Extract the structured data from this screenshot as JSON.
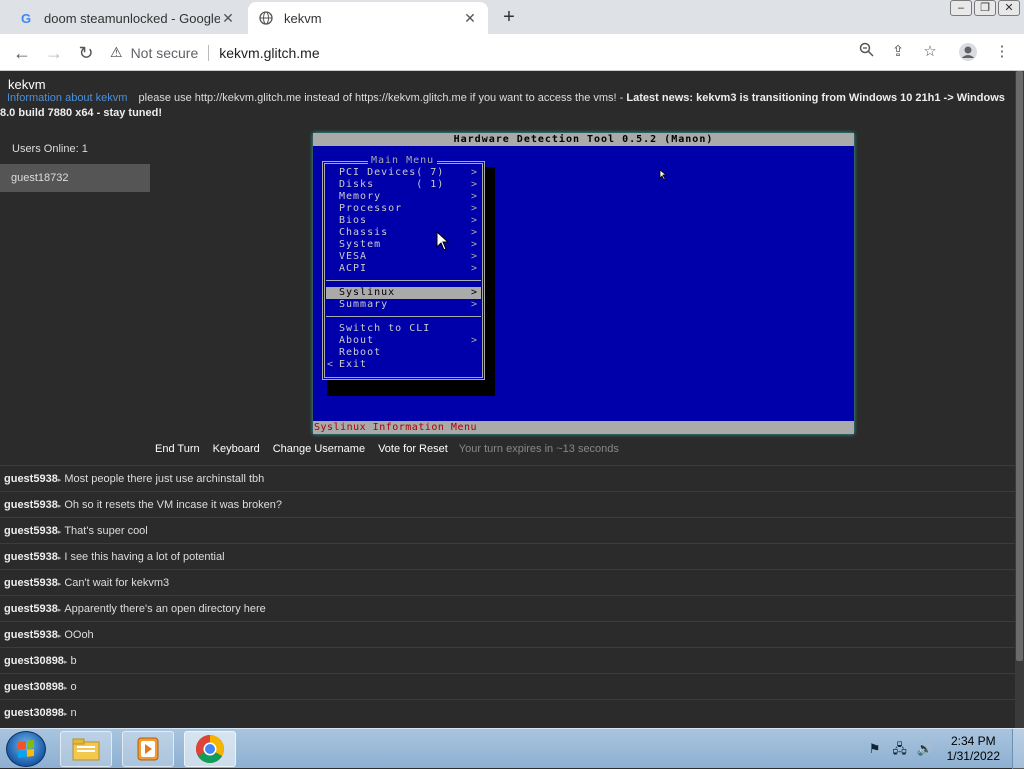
{
  "browser": {
    "tabs": [
      {
        "title": "doom steamunlocked - Google S",
        "favicon": "google-g-icon"
      },
      {
        "title": "kekvm",
        "favicon": "globe-icon"
      }
    ],
    "new_tab": "+",
    "window_controls": [
      "minimize",
      "restore",
      "close"
    ],
    "security_label": "Not secure",
    "url": "kekvm.glitch.me"
  },
  "site": {
    "title": "kekvm",
    "info_link": "Information about kekvm",
    "notice": "please use http://kekvm.glitch.me instead of https://kekvm.glitch.me if you want to access the vms!",
    "news_sep": " - ",
    "news": "Latest news: kekvm3 is transitioning from Windows 10 21h1 -> Windows 8.0 build 7880 x64 - stay tuned!",
    "users_online": "Users Online: 1",
    "users": [
      "guest18732"
    ]
  },
  "vm": {
    "title": "Hardware Detection Tool 0.5.2 (Manon)",
    "menu_title": "Main Menu",
    "items": [
      {
        "label": "PCI Devices( 7)",
        "arrow": ">",
        "type": "item"
      },
      {
        "label": "Disks      ( 1)",
        "arrow": ">",
        "type": "item"
      },
      {
        "label": "Memory",
        "arrow": ">",
        "type": "item"
      },
      {
        "label": "Processor",
        "arrow": ">",
        "type": "item"
      },
      {
        "label": "Bios",
        "arrow": ">",
        "type": "item"
      },
      {
        "label": "Chassis",
        "arrow": ">",
        "type": "item"
      },
      {
        "label": "System",
        "arrow": ">",
        "type": "item"
      },
      {
        "label": "VESA",
        "arrow": ">",
        "type": "item"
      },
      {
        "label": "ACPI",
        "arrow": ">",
        "type": "item"
      },
      {
        "type": "sep"
      },
      {
        "label": "Syslinux",
        "arrow": ">",
        "type": "item",
        "selected": true
      },
      {
        "label": "Summary",
        "arrow": ">",
        "type": "item"
      },
      {
        "type": "sep"
      },
      {
        "label": "Switch to CLI",
        "arrow": "",
        "type": "item"
      },
      {
        "label": "About",
        "arrow": ">",
        "type": "item"
      },
      {
        "label": "Reboot",
        "arrow": "",
        "type": "item"
      },
      {
        "label": "Exit",
        "arrow": "",
        "left_arrow": "<",
        "type": "item"
      }
    ],
    "status": "Syslinux Information Menu"
  },
  "controls": {
    "end_turn": "End Turn",
    "keyboard": "Keyboard",
    "change_username": "Change Username",
    "vote_reset": "Vote for Reset",
    "turn_status": "Your turn expires in ~13 seconds"
  },
  "chat": [
    {
      "user": "guest5938",
      "msg": "Most people there just use archinstall tbh"
    },
    {
      "user": "guest5938",
      "msg": "Oh so it resets the VM incase it was broken?"
    },
    {
      "user": "guest5938",
      "msg": "That's super cool"
    },
    {
      "user": "guest5938",
      "msg": "I see this having a lot of potential"
    },
    {
      "user": "guest5938",
      "msg": "Can't wait for kekvm3"
    },
    {
      "user": "guest5938",
      "msg": "Apparently there's an open directory here"
    },
    {
      "user": "guest5938",
      "msg": "OOoh"
    },
    {
      "user": "guest30898",
      "msg": "b"
    },
    {
      "user": "guest30898",
      "msg": "o"
    },
    {
      "user": "guest30898",
      "msg": "n"
    }
  ],
  "taskbar": {
    "apps": [
      "explorer-icon",
      "media-player-icon",
      "chrome-icon"
    ],
    "time": "2:34 PM",
    "date": "1/31/2022"
  }
}
